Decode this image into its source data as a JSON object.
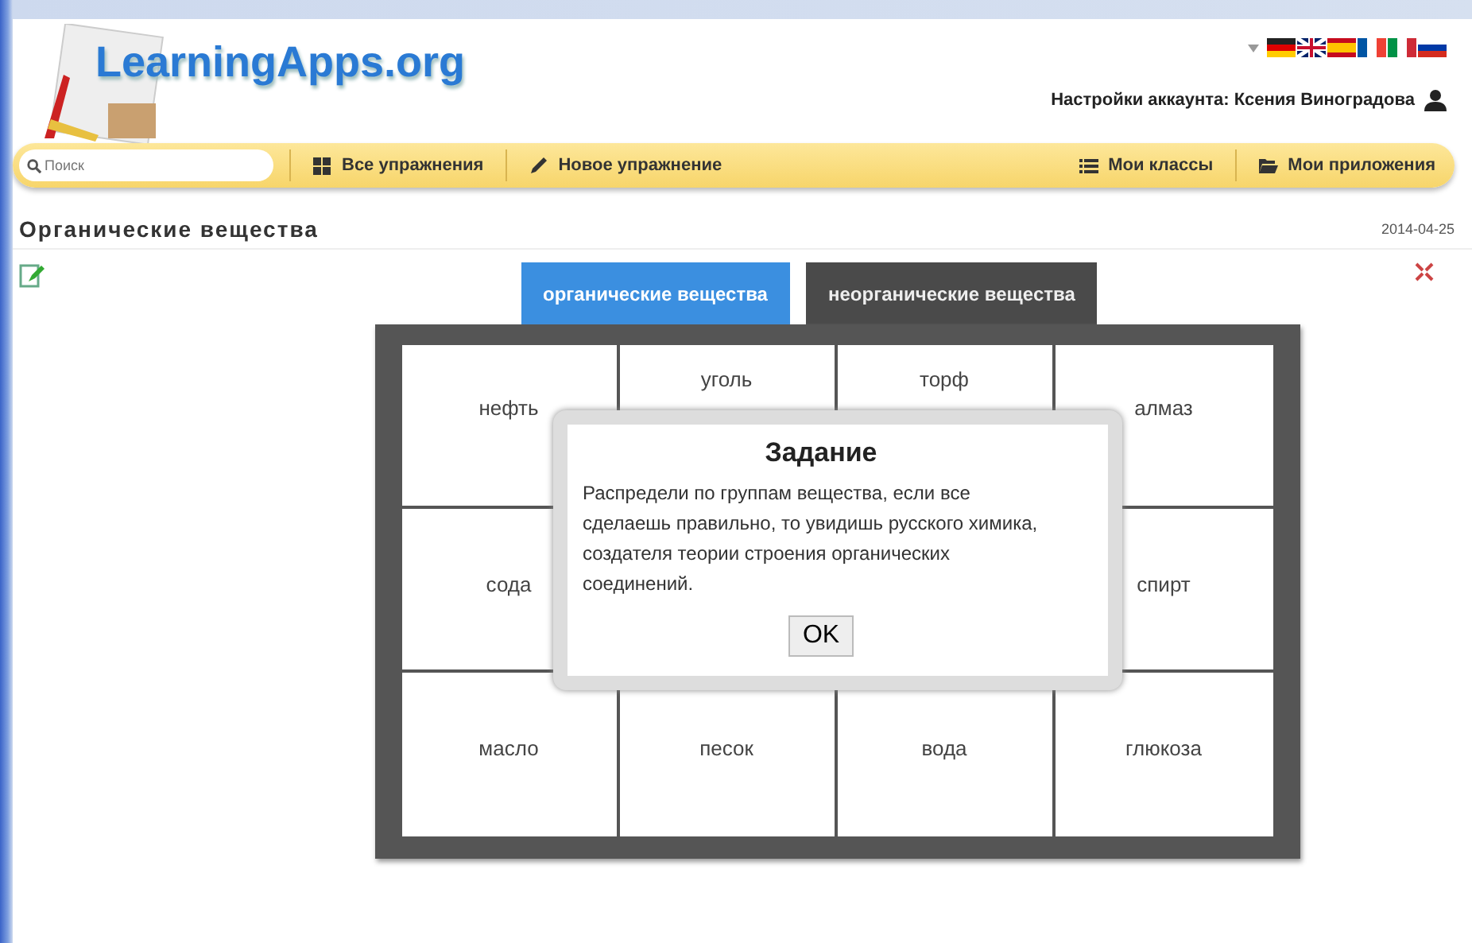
{
  "logo": "LearningApps.org",
  "account": "Настройки аккаунта: Ксения Виноградова",
  "search": {
    "placeholder": "Поиск"
  },
  "nav_left": [
    "Все упражнения",
    "Новое упражнение"
  ],
  "nav_right": [
    "Мои классы",
    "Мои приложения"
  ],
  "page_title": "Органические вещества",
  "date": "2014-04-25",
  "tabs": [
    {
      "label": "органические вещества",
      "selected": true
    },
    {
      "label": "неорганические вещества",
      "selected": false
    }
  ],
  "cells": [
    "нефть",
    "уголь",
    "торф",
    "алмаз",
    "сода",
    "спирт",
    "масло",
    "песок",
    "вода",
    "глюкоза"
  ],
  "dialog": {
    "title": "Задание",
    "text": "Распредели по группам вещества, если все сделаешь правильно, то увидишь русского химика, создателя теории строения органических соединений.",
    "button": "OK"
  }
}
